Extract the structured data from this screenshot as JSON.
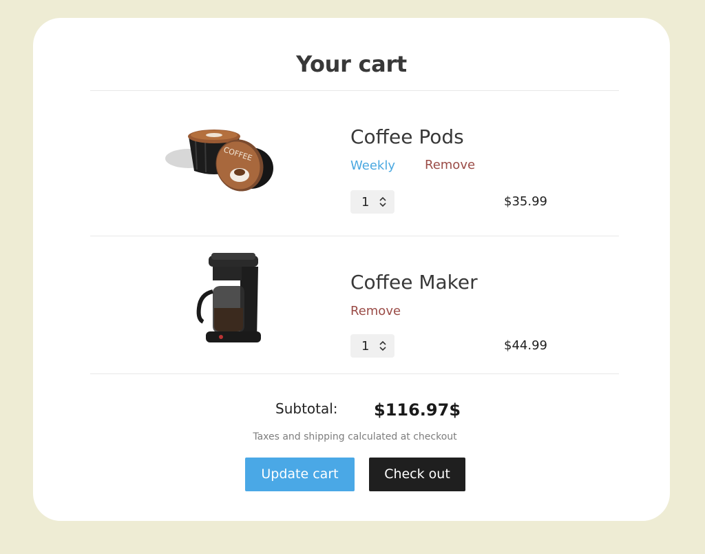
{
  "cart": {
    "title": "Your cart",
    "items": [
      {
        "name": "Coffee Pods",
        "frequency": "Weekly",
        "remove_label": "Remove",
        "quantity": "1",
        "price": "$35.99",
        "pod_label": "COFFEE"
      },
      {
        "name": "Coffee Maker",
        "remove_label": "Remove",
        "quantity": "1",
        "price": "$44.99"
      }
    ],
    "subtotal_label": "Subtotal:",
    "subtotal_value": "$116.97$",
    "tax_note": "Taxes and shipping calculated at checkout",
    "update_button": "Update cart",
    "checkout_button": "Check out"
  },
  "colors": {
    "background": "#eeecd4",
    "card": "#ffffff",
    "link_blue": "#4aa8e0",
    "remove_red": "#9a4b46",
    "update_button": "#4aa8e6",
    "checkout_button": "#1f1f1f"
  },
  "icons": [
    "coffee-pods-image",
    "coffee-maker-image",
    "stepper-arrows-icon"
  ]
}
